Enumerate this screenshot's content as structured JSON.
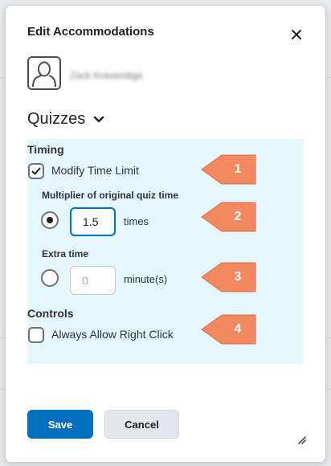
{
  "dialog": {
    "title": "Edit Accommodations",
    "close_icon": "close-icon",
    "student": {
      "avatar_icon": "user-avatar-icon",
      "name": "Zack Kravendiga"
    }
  },
  "section": {
    "title": "Quizzes",
    "icon": "chevron-down-icon"
  },
  "timing": {
    "heading": "Timing",
    "modify_time_limit": {
      "label": "Modify Time Limit",
      "checked": true
    },
    "multiplier": {
      "label": "Multiplier of original quiz time",
      "value": "1.5",
      "unit": "times",
      "selected": true
    },
    "extra_time": {
      "label": "Extra time",
      "placeholder": "0",
      "unit": "minute(s)",
      "selected": false
    }
  },
  "controls": {
    "heading": "Controls",
    "always_allow_right_click": {
      "label": "Always Allow Right Click",
      "checked": false
    }
  },
  "callouts": [
    "1",
    "2",
    "3",
    "4"
  ],
  "buttons": {
    "save": "Save",
    "cancel": "Cancel"
  },
  "colors": {
    "primary": "#006fbf",
    "panel_highlight": "#e3f7fd",
    "callout": "#f4885f"
  }
}
